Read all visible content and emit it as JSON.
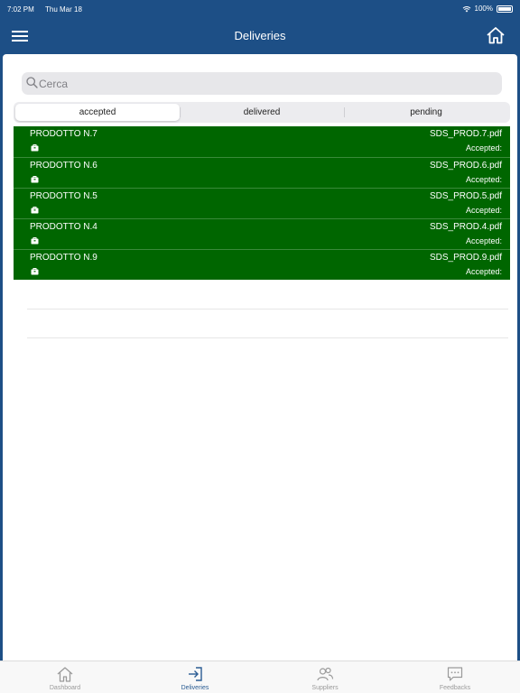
{
  "status_bar": {
    "time": "7:02 PM",
    "date": "Thu Mar 18",
    "battery": "100%"
  },
  "header": {
    "title": "Deliveries",
    "menu_icon": "hamburger-icon",
    "home_icon": "home-icon"
  },
  "search": {
    "placeholder": "Cerca",
    "value": ""
  },
  "segments": [
    {
      "label": "accepted",
      "active": true
    },
    {
      "label": "delivered",
      "active": false
    },
    {
      "label": "pending",
      "active": false
    }
  ],
  "deliveries": [
    {
      "product": "PRODOTTO N.7",
      "file": "SDS_PROD.7.pdf",
      "status": "Accepted:"
    },
    {
      "product": "PRODOTTO N.6",
      "file": "SDS_PROD.6.pdf",
      "status": "Accepted:"
    },
    {
      "product": "PRODOTTO N.5",
      "file": "SDS_PROD.5.pdf",
      "status": "Accepted:"
    },
    {
      "product": "PRODOTTO N.4",
      "file": "SDS_PROD.4.pdf",
      "status": "Accepted:"
    },
    {
      "product": "PRODOTTO N.9",
      "file": "SDS_PROD.9.pdf",
      "status": "Accepted:"
    }
  ],
  "tab_bar": [
    {
      "label": "Dashboard",
      "icon": "home-icon",
      "active": false
    },
    {
      "label": "Deliveries",
      "icon": "login-arrow-icon",
      "active": true
    },
    {
      "label": "Suppliers",
      "icon": "users-icon",
      "active": false
    },
    {
      "label": "Feedbacks",
      "icon": "chat-bubble-icon",
      "active": false
    }
  ],
  "colors": {
    "header": "#1d4f86",
    "row_background": "#006600",
    "active_tab": "#2a5c93",
    "inactive_tab": "#9a9a9a"
  }
}
